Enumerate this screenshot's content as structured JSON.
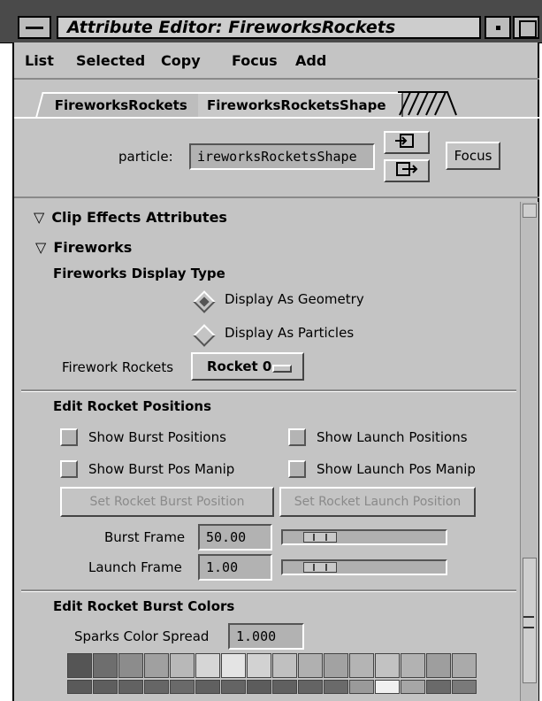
{
  "window": {
    "title": "Attribute Editor: FireworksRockets"
  },
  "menubar": {
    "items": [
      "List",
      "Selected",
      "Copy",
      "Focus",
      "Add"
    ]
  },
  "tabs": {
    "items": [
      "FireworksRockets",
      "FireworksRocketsShape"
    ],
    "active": "FireworksRocketsShape"
  },
  "node": {
    "label": "particle:",
    "value": "ireworksRocketsShape",
    "focus_label": "Focus"
  },
  "sections": {
    "clip_effects": "Clip Effects Attributes",
    "fireworks": "Fireworks",
    "display_type": "Fireworks Display Type",
    "edit_positions": "Edit Rocket Positions",
    "edit_colors": "Edit Rocket Burst Colors"
  },
  "display_options": {
    "geometry": "Display As Geometry",
    "particles": "Display As Particles",
    "selected": "Display As Geometry"
  },
  "rockets": {
    "label": "Firework Rockets",
    "value": "Rocket 0"
  },
  "checkboxes": {
    "show_burst": "Show Burst Positions",
    "show_launch": "Show Launch Positions",
    "show_burst_manip": "Show Burst Pos Manip",
    "show_launch_manip": "Show Launch Pos Manip"
  },
  "buttons": {
    "set_burst": "Set Rocket Burst Position",
    "set_launch": "Set Rocket Launch Position"
  },
  "burst_frame": {
    "label": "Burst Frame",
    "value": "50.00",
    "slider_fraction": 0.1
  },
  "launch_frame": {
    "label": "Launch Frame",
    "value": "1.00",
    "slider_fraction": 0.1
  },
  "sparks": {
    "label": "Sparks Color Spread",
    "value": "1.000"
  },
  "colors": {
    "title_bg": "#4a4a4a",
    "panel_bg": "#c4c4c4",
    "swatch_row1": [
      "#555555",
      "#6e6e6e",
      "#8c8c8c",
      "#a0a0a0",
      "#b8b8b8",
      "#d6d6d6",
      "#e4e4e4",
      "#d2d2d2",
      "#c0c0c0",
      "#b0b0b0",
      "#a2a2a2",
      "#b4b4b4",
      "#c2c2c2",
      "#b2b2b2",
      "#9e9e9e",
      "#aaaaaa"
    ],
    "swatch_row2": [
      "#5a5a5a",
      "#5e5e5e",
      "#626262",
      "#666666",
      "#6a6a6a",
      "#606060",
      "#646464",
      "#5c5c5c",
      "#606060",
      "#646464",
      "#6a6a6a",
      "#9a9a9a",
      "#f0f0f0",
      "#a6a6a6",
      "#6a6a6a",
      "#7a7a7a"
    ]
  }
}
